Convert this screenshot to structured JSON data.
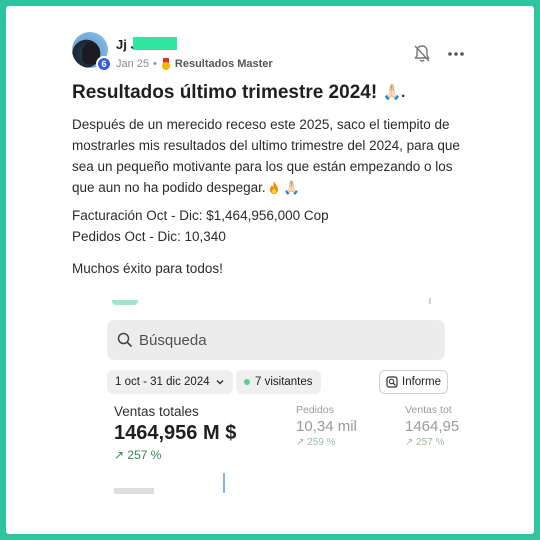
{
  "post": {
    "author_name": "Jj Ja",
    "level": "6",
    "date": "Jan 25",
    "separator": "•",
    "group": "Resultados Master",
    "title": "Resultados último trimestre 2024!",
    "title_emoji": "🙏🏻.",
    "body": "Después de un merecido receso este 2025, saco el tiempito de mostrarles mis resultados del ultimo trimestre del 2024, para que sea un pequeño motivante para los que están empezando o los que aun no ha podido despegar.",
    "body_emoji": "🙏🏻",
    "facturacion": "Facturación Oct - Dic: $1,464,956,000 Cop",
    "pedidos": "Pedidos Oct - Dic: 10,340",
    "closing": "Muchos éxito para todos!"
  },
  "icons": {
    "bell": "bell-icon",
    "more": "more-horizontal-icon",
    "medal": "medal-icon",
    "fire": "fire-icon",
    "search": "search-icon",
    "chevron": "chevron-down-icon",
    "report": "report-icon"
  },
  "screenshot": {
    "search_placeholder": "Búsqueda",
    "date_range": "1 oct - 31 dic 2024",
    "date_chevron": "⌄",
    "visitors": "7 visitantes",
    "report": "Informe",
    "metrics": {
      "main": {
        "label": "Ventas totales",
        "value": "1464,956 M $",
        "change": "↗ 257 %"
      },
      "orders": {
        "label": "Pedidos",
        "value": "10,34 mil",
        "change": "↗ 259 %"
      },
      "sales_cut": {
        "label": "Ventas tot",
        "value": "1464,95",
        "change": "↗ 257 %"
      }
    }
  },
  "colors": {
    "frame": "#2ec4a0",
    "level_badge": "#3b5bdb",
    "positive": "#2f8a4f"
  }
}
